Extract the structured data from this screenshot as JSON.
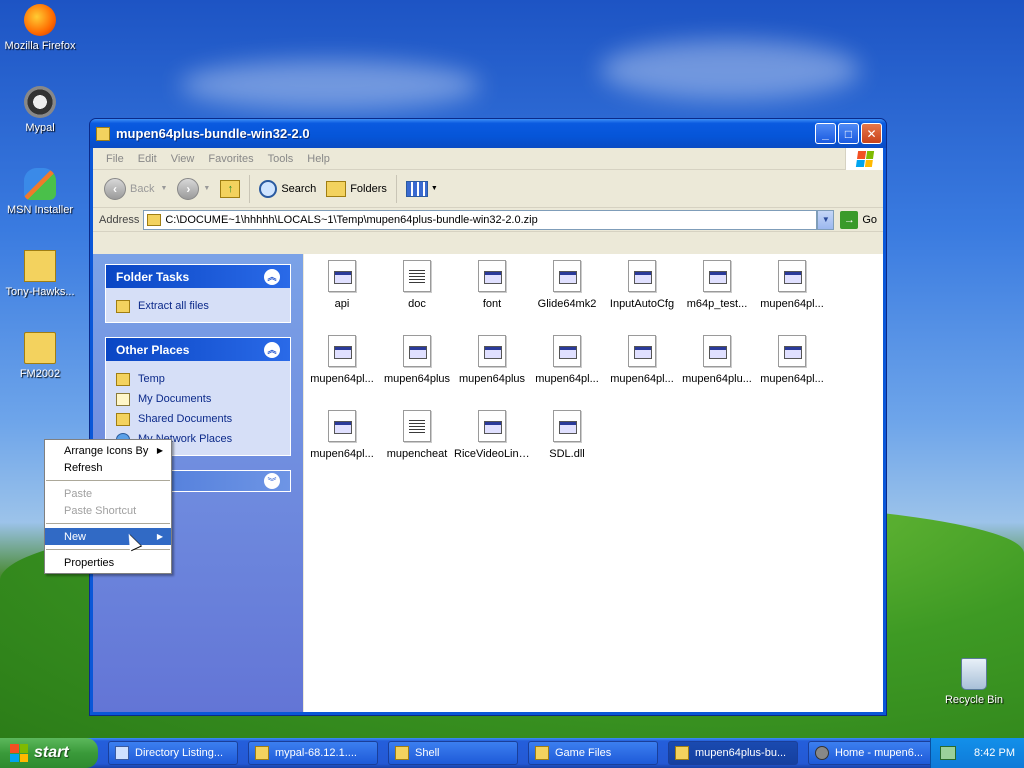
{
  "desktop": {
    "icons": [
      {
        "name": "firefox-desktop-icon",
        "label": "Mozilla Firefox"
      },
      {
        "name": "mypal-desktop-icon",
        "label": "Mypal"
      },
      {
        "name": "msn-installer-desktop-icon",
        "label": "MSN Installer"
      },
      {
        "name": "tony-hawks-desktop-icon",
        "label": "Tony-Hawks..."
      },
      {
        "name": "fm2002-desktop-icon",
        "label": "FM2002"
      },
      {
        "name": "recycle-bin-desktop-icon",
        "label": "Recycle Bin"
      }
    ]
  },
  "window": {
    "title": "mupen64plus-bundle-win32-2.0",
    "menu": [
      "File",
      "Edit",
      "View",
      "Favorites",
      "Tools",
      "Help"
    ],
    "toolbar": {
      "back": "Back",
      "search": "Search",
      "folders": "Folders"
    },
    "address": {
      "label": "Address",
      "value": "C:\\DOCUME~1\\hhhhh\\LOCALS~1\\Temp\\mupen64plus-bundle-win32-2.0.zip",
      "go": "Go"
    }
  },
  "left_pane": {
    "folder_tasks": {
      "title": "Folder Tasks",
      "items": [
        "Extract all files"
      ]
    },
    "other_places": {
      "title": "Other Places",
      "items": [
        "Temp",
        "My Documents",
        "Shared Documents",
        "My Network Places"
      ]
    }
  },
  "files": [
    "api",
    "doc",
    "font",
    "Glide64mk2",
    "InputAutoCfg",
    "m64p_test...",
    "mupen64pl...",
    "mupen64pl...",
    "mupen64plus",
    "mupen64plus",
    "mupen64pl...",
    "mupen64pl...",
    "mupen64plu...",
    "mupen64pl...",
    "mupen64pl...",
    "mupencheat",
    "RiceVideoLinux",
    "SDL.dll"
  ],
  "context_menu": {
    "arrange": "Arrange Icons By",
    "refresh": "Refresh",
    "paste": "Paste",
    "paste_shortcut": "Paste Shortcut",
    "new": "New",
    "properties": "Properties"
  },
  "taskbar": {
    "start": "start",
    "buttons": [
      "Directory Listing...",
      "mypal-68.12.1....",
      "Shell",
      "Game Files",
      "mupen64plus-bu...",
      "Home - mupen6..."
    ],
    "clock": "8:42 PM"
  },
  "colors": {
    "accent": "#316ac5",
    "titlebar": "#0655d8",
    "task_link": "#0c2a8a"
  }
}
